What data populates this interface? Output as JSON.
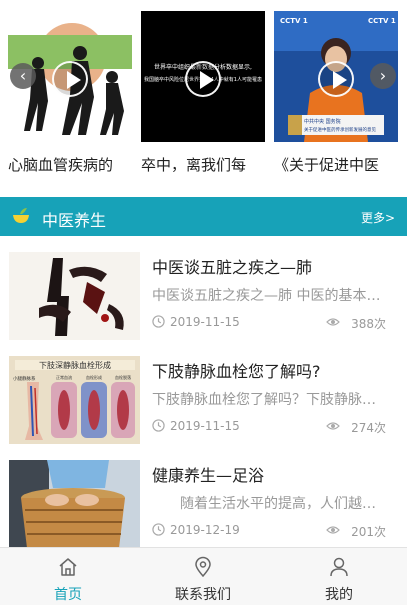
{
  "carousel": {
    "videos": [
      {
        "caption": "心脑血管疾病的"
      },
      {
        "caption": "卒中，离我们每",
        "overlay_lines": [
          "世界卒中组织最新数据分析数据显示,",
          "我国脑卒中风险位居世界第一,4人中就有1人可能罹患"
        ]
      },
      {
        "caption": "《关于促进中医",
        "logo": "CCTV 1",
        "lower_third": [
          "中共中央 国务院",
          "关于促进中医药传承创新发展的意见"
        ]
      }
    ],
    "prev_icon": "chevron-left-icon",
    "next_icon": "chevron-right-icon"
  },
  "section": {
    "title": "中医养生",
    "more_label": "更多>",
    "accent_color": "#17a2b8"
  },
  "articles": [
    {
      "title": "中医谈五脏之疾之—肺",
      "excerpt": "中医谈五脏之疾之—肺 中医的基本理论",
      "date": "2019-11-15",
      "views": "388次"
    },
    {
      "title": "下肢静脉血栓您了解吗?",
      "excerpt": "下肢静脉血栓您了解吗？下肢静脉血栓",
      "date": "2019-11-15",
      "views": "274次",
      "thumb_heading": "下肢深静脉血栓形成",
      "thumb_labels": [
        "正常血流",
        "血栓形成",
        "血栓脱落"
      ],
      "thumb_side_label": "小腿静脉系"
    },
    {
      "title": "健康养生—足浴",
      "excerpt": "　　随着生活水平的提高，人们越来越",
      "date": "2019-12-19",
      "views": "201次"
    }
  ],
  "nav": {
    "items": [
      {
        "label": "首页",
        "icon": "home-icon",
        "active": true
      },
      {
        "label": "联系我们",
        "icon": "location-pin-icon",
        "active": false
      },
      {
        "label": "我的",
        "icon": "user-icon",
        "active": false
      }
    ],
    "active_color": "#17a2b8"
  }
}
